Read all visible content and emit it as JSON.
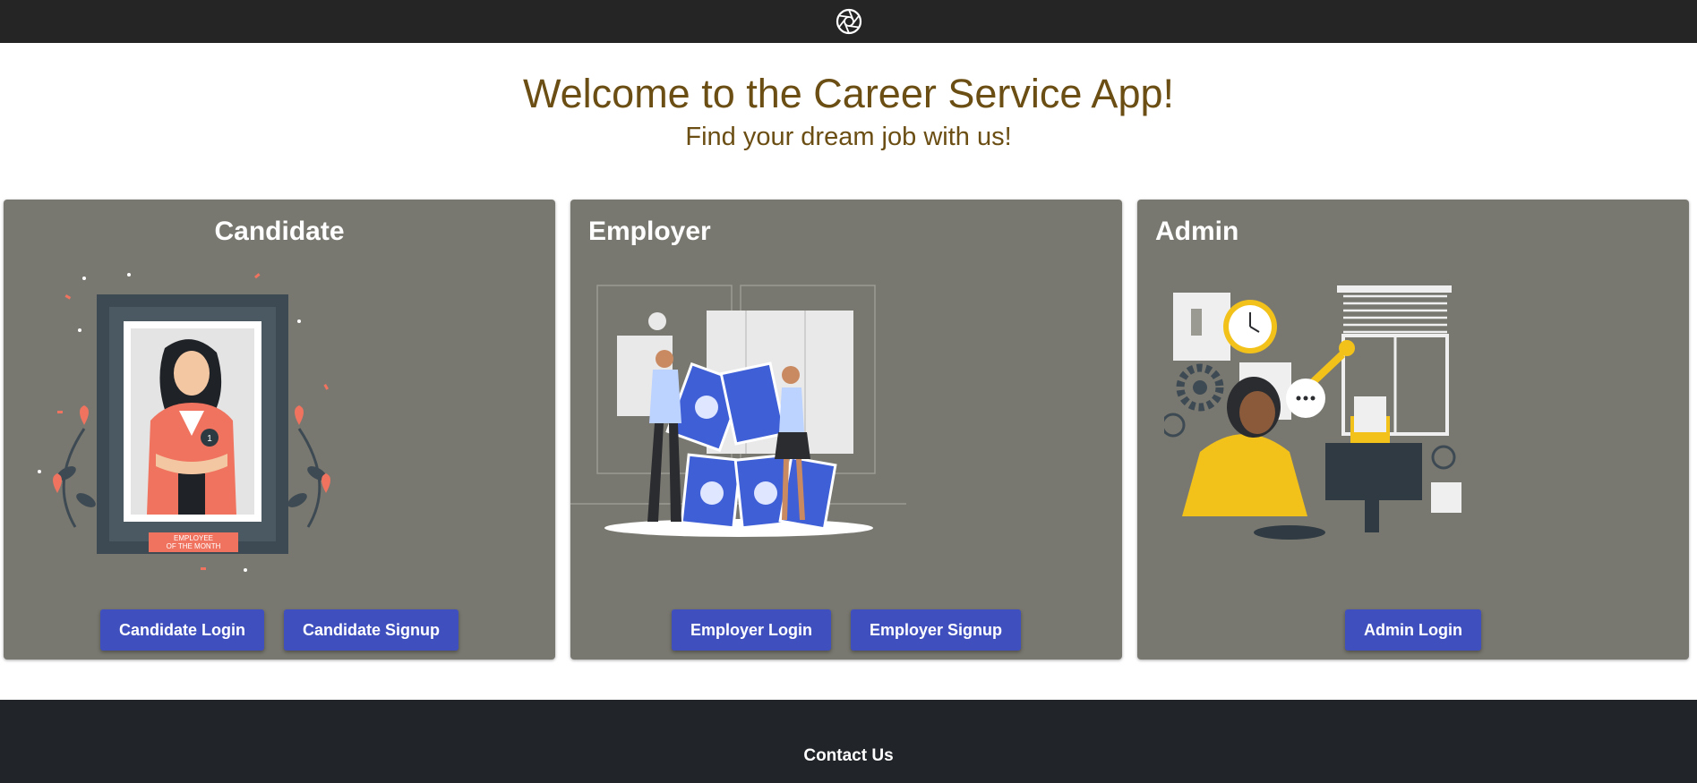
{
  "header": {
    "logo_icon": "aperture-icon",
    "background": "#252525"
  },
  "hero": {
    "title": "Welcome to the Career Service App!",
    "subtitle": "Find your dream job with us!",
    "text_color": "#6b4e13"
  },
  "cards": [
    {
      "title": "Candidate",
      "illustration_icon": "employee-of-the-month-illustration",
      "badge_text_line1": "EMPLOYEE",
      "badge_text_line2": "OF THE MONTH",
      "buttons": [
        "Candidate Login",
        "Candidate Signup"
      ]
    },
    {
      "title": "Employer",
      "illustration_icon": "house-of-cards-illustration",
      "buttons": [
        "Employer Login",
        "Employer Signup"
      ]
    },
    {
      "title": "Admin",
      "illustration_icon": "admin-support-illustration",
      "buttons": [
        "Admin Login"
      ]
    }
  ],
  "colors": {
    "card_bg": "#797870",
    "button_bg": "#3f4fbe",
    "footer_bg": "#212429"
  },
  "footer": {
    "title": "Contact Us"
  }
}
